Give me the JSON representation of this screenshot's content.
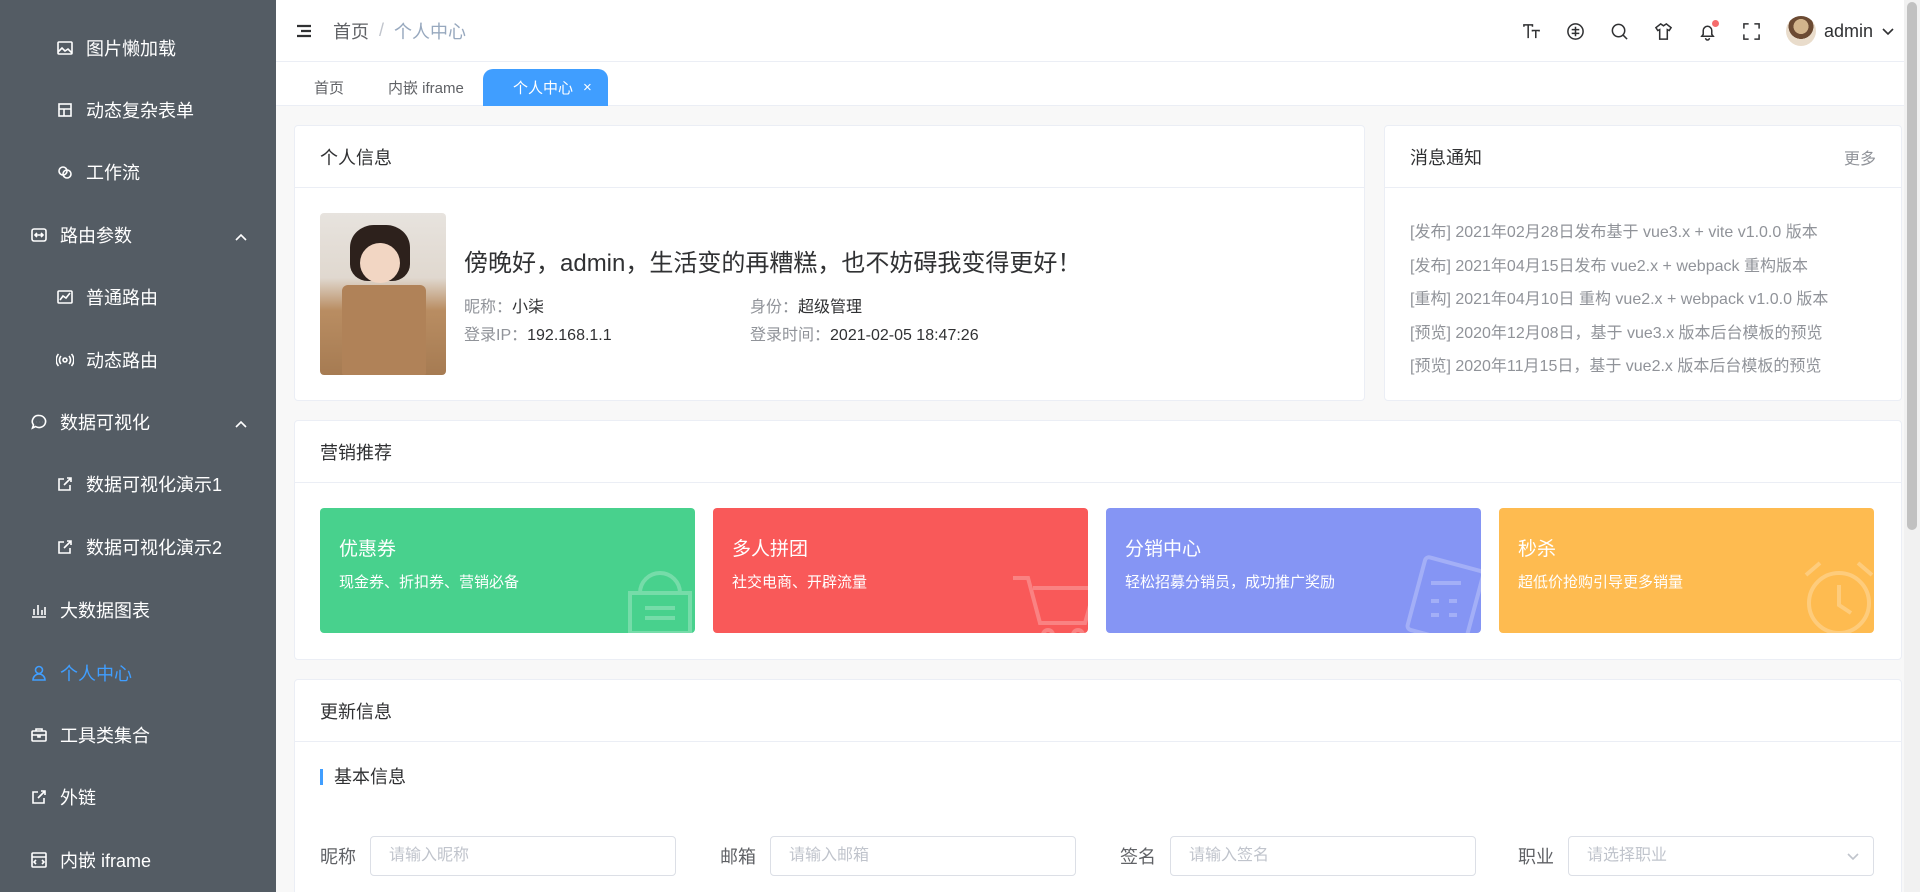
{
  "sidebar": {
    "items": [
      {
        "label": "图片懒加载",
        "icon": "image-icon",
        "level": 1
      },
      {
        "label": "动态复杂表单",
        "icon": "form-icon",
        "level": 1
      },
      {
        "label": "工作流",
        "icon": "workflow-icon",
        "level": 1
      },
      {
        "label": "路由参数",
        "icon": "route-icon",
        "level": 0,
        "expanded": true
      },
      {
        "label": "普通路由",
        "icon": "chart-line-icon",
        "level": 1
      },
      {
        "label": "动态路由",
        "icon": "broadcast-icon",
        "level": 1
      },
      {
        "label": "数据可视化",
        "icon": "chat-bubble-icon",
        "level": 0,
        "expanded": true
      },
      {
        "label": "数据可视化演示1",
        "icon": "external-link-icon",
        "level": 1
      },
      {
        "label": "数据可视化演示2",
        "icon": "external-link-icon",
        "level": 1
      },
      {
        "label": "大数据图表",
        "icon": "bar-chart-icon",
        "level": 0
      },
      {
        "label": "个人中心",
        "icon": "user-icon",
        "level": 0,
        "active": true
      },
      {
        "label": "工具类集合",
        "icon": "toolbox-icon",
        "level": 0
      },
      {
        "label": "外链",
        "icon": "external-link-icon",
        "level": 0
      },
      {
        "label": "内嵌 iframe",
        "icon": "iframe-icon",
        "level": 0
      }
    ]
  },
  "header": {
    "breadcrumb": [
      "首页",
      "个人中心"
    ],
    "breadcrumb_sep": "/",
    "username": "admin",
    "icons": [
      "font-size-icon",
      "language-icon",
      "search-icon",
      "skin-icon",
      "bell-icon",
      "fullscreen-icon"
    ]
  },
  "tags": [
    {
      "label": "首页"
    },
    {
      "label": "内嵌 iframe"
    },
    {
      "label": "个人中心",
      "active": true,
      "close": "×"
    }
  ],
  "profile": {
    "title": "个人信息",
    "greeting": "傍晚好，admin，生活变的再糟糕，也不妨碍我变得更好！",
    "nickname_label": "昵称：",
    "nickname": "小柒",
    "role_label": "身份：",
    "role": "超级管理",
    "ip_label": "登录IP：",
    "ip": "192.168.1.1",
    "login_time_label": "登录时间：",
    "login_time": "2021-02-05 18:47:26"
  },
  "notice": {
    "title": "消息通知",
    "more": "更多",
    "items": [
      "[发布] 2021年02月28日发布基于 vue3.x + vite v1.0.0 版本",
      "[发布] 2021年04月15日发布 vue2.x + webpack 重构版本",
      "[重构] 2021年04月10日 重构 vue2.x + webpack v1.0.0 版本",
      "[预览] 2020年12月08日，基于 vue3.x 版本后台模板的预览",
      "[预览] 2020年11月15日，基于 vue2.x 版本后台模板的预览"
    ]
  },
  "marketing": {
    "title": "营销推荐",
    "cards": [
      {
        "title": "优惠券",
        "desc": "现金券、折扣券、营销必备",
        "color": "#48d18d",
        "icon": "coupon-icon"
      },
      {
        "title": "多人拼团",
        "desc": "社交电商、开辟流量",
        "color": "#f95959",
        "icon": "cart-icon"
      },
      {
        "title": "分销中心",
        "desc": "轻松招募分销员，成功推广奖励",
        "color": "#8595f4",
        "icon": "calculator-icon"
      },
      {
        "title": "秒杀",
        "desc": "超低价抢购引导更多销量",
        "color": "#febb50",
        "icon": "alarm-clock-icon"
      }
    ]
  },
  "update": {
    "title": "更新信息",
    "section": "基本信息",
    "fields": [
      {
        "label": "昵称",
        "placeholder": "请输入昵称"
      },
      {
        "label": "邮箱",
        "placeholder": "请输入邮箱"
      },
      {
        "label": "签名",
        "placeholder": "请输入签名"
      },
      {
        "label": "职业",
        "placeholder": "请选择职业",
        "select": true
      }
    ]
  },
  "colors": {
    "sidebar_bg": "#545c64",
    "accent": "#409eff"
  }
}
